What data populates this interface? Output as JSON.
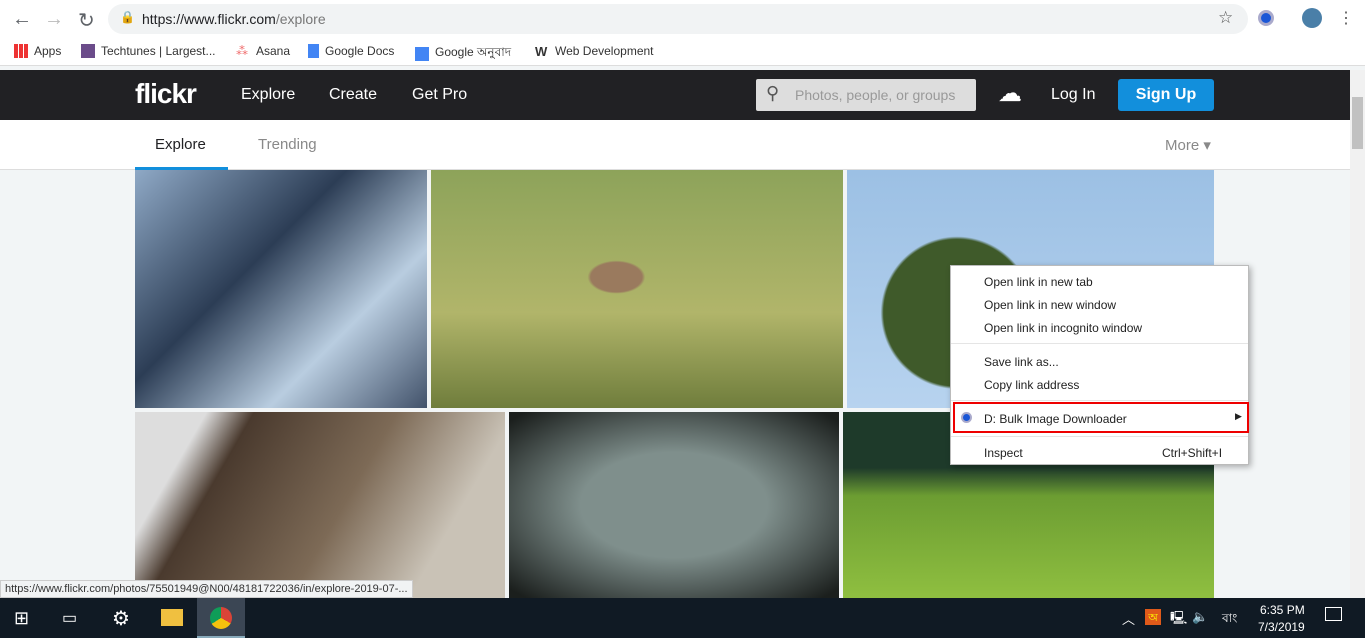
{
  "browser": {
    "url_host": "https://www.flickr.com",
    "url_path": "/explore",
    "bookmarks": [
      {
        "label": "Apps"
      },
      {
        "label": "Techtunes | Largest..."
      },
      {
        "label": "Asana"
      },
      {
        "label": "Google Docs"
      },
      {
        "label": "Google অনুবাদ"
      },
      {
        "label": "Web Development"
      }
    ],
    "status_url": "https://www.flickr.com/photos/75501949@N00/48181722036/in/explore-2019-07-..."
  },
  "flickr": {
    "logo": "flickr",
    "nav": [
      "Explore",
      "Create",
      "Get Pro"
    ],
    "search_placeholder": "Photos, people, or groups",
    "login": "Log In",
    "signup": "Sign Up",
    "tabs": [
      "Explore",
      "Trending"
    ],
    "more": "More ▾"
  },
  "context_menu": {
    "items": [
      "Open link in new tab",
      "Open link in new window",
      "Open link in incognito window",
      "Save link as...",
      "Copy link address",
      "D: Bulk Image Downloader",
      "Inspect"
    ],
    "inspect_shortcut": "Ctrl+Shift+I"
  },
  "taskbar": {
    "lang": "বাং",
    "time": "6:35 PM",
    "date": "7/3/2019"
  },
  "colors": {
    "accent": "#128fdc",
    "header": "#212124",
    "highlight": "#e00000"
  }
}
